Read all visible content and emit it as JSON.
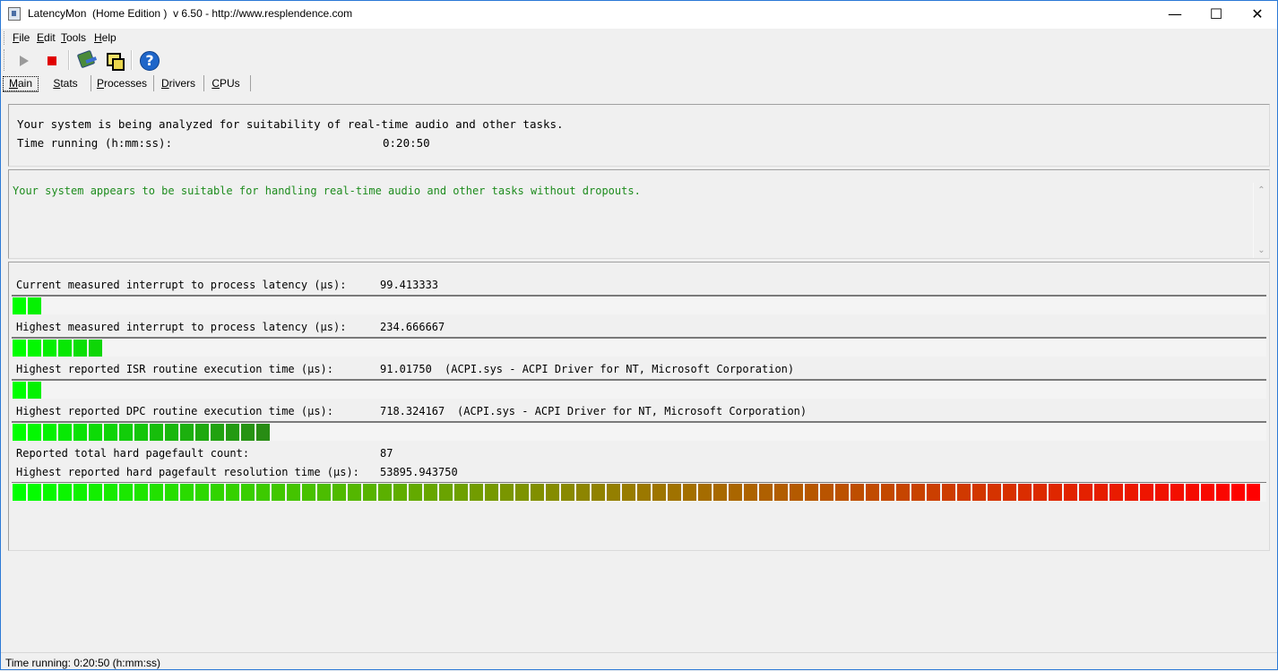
{
  "window": {
    "title": "LatencyMon  (Home Edition )  v 6.50 - http://www.resplendence.com",
    "minimize_glyph": "—",
    "maximize_glyph": "☐",
    "close_glyph": "✕"
  },
  "menu": [
    "File",
    "Edit",
    "Tools",
    "Help"
  ],
  "toolbar": {
    "icons": [
      "play-icon",
      "stop-icon",
      "analyze-drivers-icon",
      "windows-icon",
      "help-icon"
    ],
    "help_glyph": "?"
  },
  "tabs": [
    "Main",
    "Stats",
    "Processes",
    "Drivers",
    "CPUs"
  ],
  "status_panel": {
    "line1": "Your system is being analyzed for suitability of real-time audio and other tasks.",
    "time_label": "Time running (h:mm:ss):",
    "time_value": "0:20:50"
  },
  "verdict": {
    "text": "Your system appears to be suitable for handling real-time audio and other tasks without dropouts.",
    "color": "#1e8c1e"
  },
  "metrics": {
    "current_latency": {
      "label": "Current measured interrupt to process latency (µs):",
      "value": "99.413333",
      "segments": 2
    },
    "highest_latency": {
      "label": "Highest measured interrupt to process latency (µs):",
      "value": "234.666667",
      "segments": 6
    },
    "isr": {
      "label": "Highest reported ISR routine execution time (µs):",
      "value": "91.01750",
      "detail": "(ACPI.sys - ACPI Driver for NT, Microsoft Corporation)",
      "segments": 2
    },
    "dpc": {
      "label": "Highest reported DPC routine execution time (µs):",
      "value": "718.324167",
      "detail": "(ACPI.sys - ACPI Driver for NT, Microsoft Corporation)",
      "segments": 17
    },
    "pagefault_count": {
      "label": "Reported total hard pagefault count:",
      "value": "87"
    },
    "pagefault_time": {
      "label": "Highest reported hard pagefault resolution time (µs):",
      "value": "53895.943750",
      "segments": 82
    }
  },
  "bar_colors": {
    "low": "#00ff00",
    "mid": "#9a7a00",
    "high": "#ff0000"
  },
  "statusbar": {
    "text": "Time running: 0:20:50  (h:mm:ss)"
  }
}
